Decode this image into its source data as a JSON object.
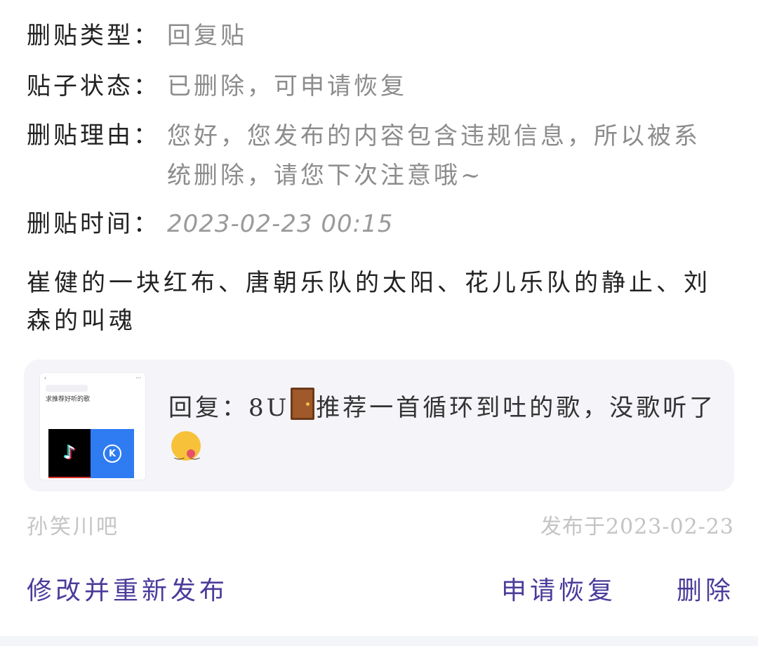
{
  "details": {
    "type_label": "删贴类型：",
    "type_value": "回复贴",
    "status_label": "贴子状态：",
    "status_value": "已删除，可申请恢复",
    "reason_label": "删贴理由：",
    "reason_value": "您好，您发布的内容包含违规信息，所以被系统删除，请您下次注意哦~",
    "time_label": "删贴时间：",
    "time_value": "2023-02-23 00:15"
  },
  "post": {
    "title": "崔健的一块红布、唐朝乐队的太阳、花儿乐队的静止、刘森的叫魂"
  },
  "reply": {
    "prefix": "回复：8U",
    "door_icon": "door-emoji-icon",
    "text": "推荐一首循环到吐的歌，没歌听了",
    "emoji_icon": "yum-face-emoji-icon",
    "thumbnail": {
      "caption": "求推荐好听的歌",
      "tile_left_icon": "tiktok-icon",
      "tile_right_letter": "K",
      "tile_left_color": "#000000",
      "tile_right_color": "#2f7bf2"
    }
  },
  "meta": {
    "forum": "孙笑川吧",
    "published": "发布于2023-02-23"
  },
  "actions": {
    "edit_label": "修改并重新发布",
    "restore_label": "申请恢复",
    "delete_label": "删除",
    "accent_color": "#4a3c9a"
  }
}
